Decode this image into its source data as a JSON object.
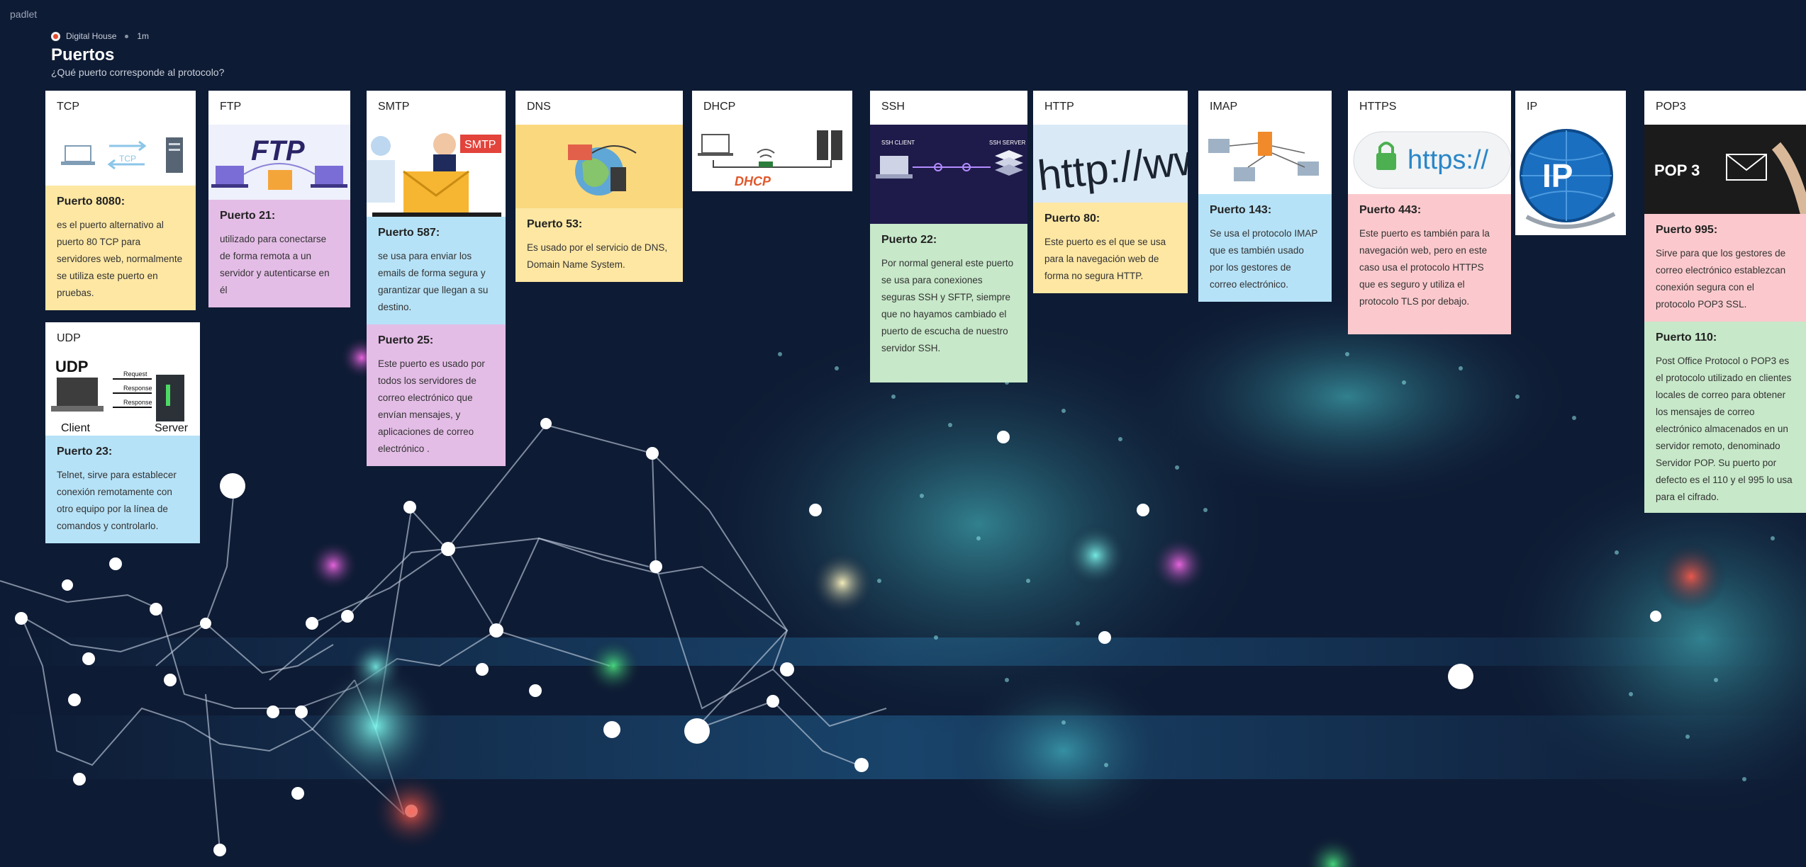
{
  "app": {
    "brand": "padlet"
  },
  "header": {
    "author": "Digital House",
    "time": "1m",
    "title": "Puertos",
    "subtitle": "¿Qué puerto corresponde al protocolo?"
  },
  "sections": {
    "tcp": {
      "title": "TCP",
      "post_title": "Puerto 8080:",
      "post_text": "es el puerto alternativo al puerto 80 TCP para servidores web, normalmente se utiliza este puerto en pruebas.",
      "img_label": "TCP"
    },
    "udp": {
      "title": "UDP",
      "post_title": "Puerto 23:",
      "post_text": " Telnet, sirve para establecer conexión remotamente con otro equipo por la línea de comandos y controlarlo.",
      "img_title": "UDP",
      "img_request": "Request",
      "img_response1": "Response",
      "img_response2": "Response",
      "img_client": "Client",
      "img_server": "Server"
    },
    "ftp": {
      "title": "FTP",
      "post_title": "Puerto 21:",
      "post_text": "utilizado para conectarse de forma remota a un servidor y autenticarse en él",
      "img_label": "FTP"
    },
    "smtp": {
      "title": "SMTP",
      "post1_title": "Puerto 587:",
      "post1_text": "se usa para enviar los emails de forma segura y garantizar que llegan a su destino.",
      "post2_title": "Puerto 25:",
      "post2_text": "Este puerto es usado por todos los servidores de correo electrónico que envían mensajes, y aplicaciones de correo electrónico .",
      "img_label": "SMTP"
    },
    "dns": {
      "title": "DNS",
      "post_title": "Puerto 53:",
      "post_text": "Es usado por el servicio de DNS, Domain Name System."
    },
    "dhcp": {
      "title": "DHCP",
      "img_label": "DHCP"
    },
    "ssh": {
      "title": "SSH",
      "post_title": "Puerto 22:",
      "post_text": "Por normal general este puerto se usa para conexiones seguras SSH y SFTP, siempre que no hayamos cambiado el puerto de escucha de nuestro servidor SSH.",
      "img_client": "SSH CLIENT",
      "img_server": "SSH SERVER"
    },
    "http": {
      "title": "HTTP",
      "post_title": "Puerto 80:",
      "post_text": "Este puerto es el que se usa para la navegación web de forma no segura HTTP.",
      "img_label": "http://ww"
    },
    "imap": {
      "title": "IMAP",
      "post_title": "Puerto 143:",
      "post_text": " Se usa el protocolo IMAP que es también usado por los gestores de correo electrónico."
    },
    "https": {
      "title": "HTTPS",
      "post_title": "Puerto 443:",
      "post_text": "Este puerto es también para la navegación web, pero en este caso usa el protocolo HTTPS que es seguro y utiliza el protocolo TLS por debajo.",
      "img_label": "https://"
    },
    "ip": {
      "title": "IP",
      "img_label": "IP"
    },
    "pop3": {
      "title": "POP3",
      "post1_title": "Puerto 995:",
      "post1_text": "Sirve para que los gestores de correo electrónico establezcan conexión segura con el protocolo POP3 SSL.",
      "post2_title": "Puerto 110:",
      "post2_text": "Post Office Protocol o POP3 es el protocolo utilizado en clientes locales de correo para obtener los mensajes de correo electrónico almacenados en un servidor remoto, denominado Servidor POP. Su puerto por defecto es el 110 y el 995 lo usa para el cifrado.",
      "img_label": "POP 3"
    }
  },
  "colors": {
    "background": "#0e1b34",
    "yellow": "#fde7a3",
    "purple": "#e4bde7",
    "blue": "#b6e2f7",
    "green": "#c7e8c9",
    "pink": "#fbc9cd"
  }
}
